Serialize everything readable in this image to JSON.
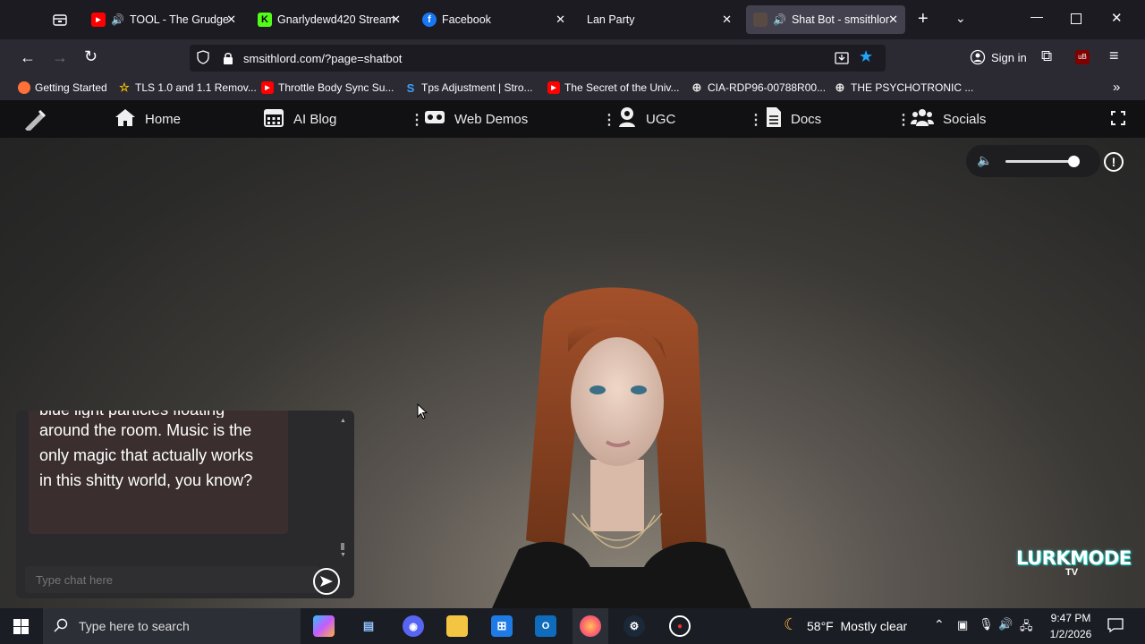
{
  "browser": {
    "tabs": [
      {
        "title": "TOOL - The Grudge",
        "audio": true,
        "favicon": "youtube-icon"
      },
      {
        "title": "Gnarlydewd420 Stream",
        "audio": false,
        "favicon": "kick-icon"
      },
      {
        "title": "Facebook",
        "audio": false,
        "favicon": "facebook-icon"
      },
      {
        "title": "Lan Party",
        "audio": false,
        "favicon": "none"
      },
      {
        "title": "Shat Bot - smsithlor",
        "audio": true,
        "favicon": "site-icon",
        "active": true
      }
    ],
    "url": "smsithlord.com/?page=shatbot",
    "sign_in_label": "Sign in",
    "bookmarks": [
      {
        "label": "Getting Started",
        "icon": "firefox-icon"
      },
      {
        "label": "TLS 1.0 and 1.1 Remov...",
        "icon": "star-icon"
      },
      {
        "label": "Throttle Body Sync Su...",
        "icon": "youtube-icon"
      },
      {
        "label": "Tps Adjustment | Stro...",
        "icon": "s-icon"
      },
      {
        "label": "The Secret of the Univ...",
        "icon": "youtube-icon"
      },
      {
        "label": "CIA-RDP96-00788R00...",
        "icon": "globe-icon"
      },
      {
        "label": "THE PSYCHOTRONIC ...",
        "icon": "globe-icon"
      }
    ]
  },
  "site_nav": {
    "items": [
      {
        "label": "Home",
        "icon": "home-icon"
      },
      {
        "label": "AI Blog",
        "icon": "calendar-icon"
      },
      {
        "label": "Web Demos",
        "icon": "vr-headset-icon"
      },
      {
        "label": "UGC",
        "icon": "user-icon"
      },
      {
        "label": "Docs",
        "icon": "document-icon"
      },
      {
        "label": "Socials",
        "icon": "users-icon"
      }
    ]
  },
  "audio": {
    "volume": 0.95
  },
  "chat": {
    "partial_line": "blue light particles floating",
    "message": "around the room. Music is the only magic that actually works in this shitty world, you know?",
    "input_placeholder": "Type chat here"
  },
  "watermark": {
    "line1": "LURKMODE",
    "line2": "TV"
  },
  "taskbar": {
    "search_placeholder": "Type here to search",
    "weather": "58°F  Mostly clear",
    "time": "9:47 PM",
    "date": "1/2/2026"
  },
  "colors": {
    "tab_active": "#42414d",
    "chrome": "#2b2a33",
    "accent_star": "#1ea7fd",
    "chat_bubble": "#3a2e2e"
  }
}
